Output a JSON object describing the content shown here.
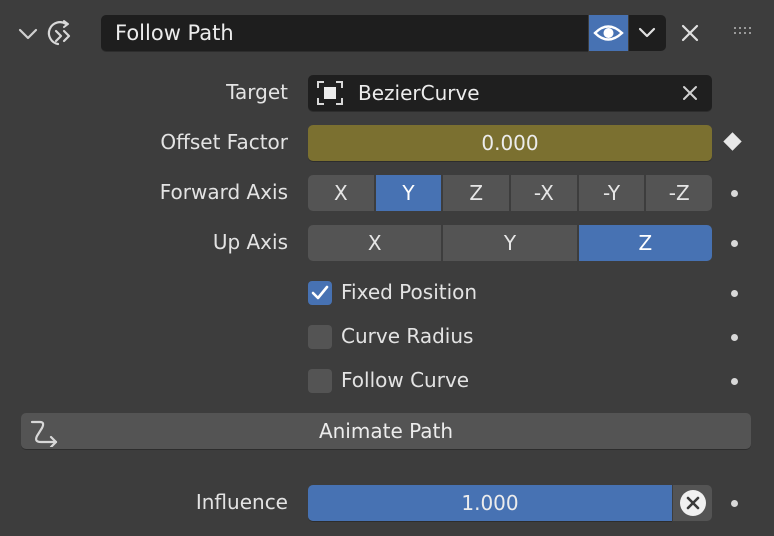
{
  "header": {
    "title": "Follow Path",
    "expand_icon": "chevron-down-icon",
    "constraint_icon": "follow-path-icon",
    "visibility_icon": "eye-icon",
    "dropdown_icon": "chevron-down-icon",
    "delete_icon": "close-icon",
    "drag_icon": "grip-icon"
  },
  "target": {
    "label": "Target",
    "value": "BezierCurve"
  },
  "offset_factor": {
    "label": "Offset Factor",
    "value": "0.000"
  },
  "forward_axis": {
    "label": "Forward Axis",
    "options": [
      "X",
      "Y",
      "Z",
      "-X",
      "-Y",
      "-Z"
    ],
    "selected": "Y"
  },
  "up_axis": {
    "label": "Up Axis",
    "options": [
      "X",
      "Y",
      "Z"
    ],
    "selected": "Z"
  },
  "checkboxes": {
    "fixed_position": {
      "label": "Fixed Position",
      "checked": true
    },
    "curve_radius": {
      "label": "Curve Radius",
      "checked": false
    },
    "follow_curve": {
      "label": "Follow Curve",
      "checked": false
    }
  },
  "animate_path": {
    "label": "Animate Path"
  },
  "influence": {
    "label": "Influence",
    "value": "1.000",
    "fraction": 1.0
  },
  "colors": {
    "accent": "#4772b3",
    "keyed_field": "#7b7030",
    "panel_bg": "#3d3d3d"
  }
}
